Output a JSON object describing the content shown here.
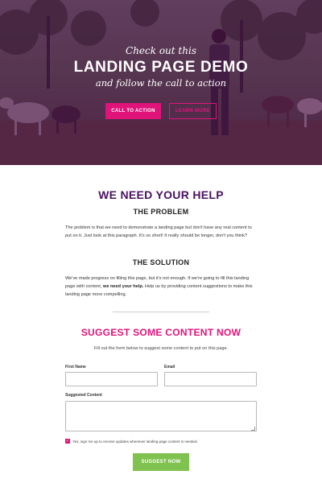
{
  "hero": {
    "kicker": "Check out this",
    "title": "LANDING PAGE DEMO",
    "subtitle": "and follow the call to action",
    "cta_label": "CALL TO ACTION",
    "learn_label": "LEARN MORE",
    "colors": {
      "overlay": "#480c4e",
      "accent": "#e0137b"
    }
  },
  "help": {
    "heading": "WE NEED YOUR HELP",
    "problem_heading": "THE PROBLEM",
    "problem_text": "The problem is that we need to demonstrate a landing page but don't have any real content to put on it. Just look at this paragraph. It's so short! It really should be longer, don't you think?",
    "solution_heading": "THE SOLUTION",
    "solution_text_before": "We've made progress on filling this page, but it's not enough. If we're going to fill this landing page with content, ",
    "solution_text_bold": "we need your help.",
    "solution_text_after": " Help us by providing content suggestions to make this landing page more compelling."
  },
  "suggest": {
    "heading": "SUGGEST SOME CONTENT NOW",
    "intro": "Fill out the form below to suggest some content to put on this page.",
    "first_name_label": "First Name",
    "first_name_value": "",
    "email_label": "Email",
    "email_value": "",
    "content_label": "Suggested Content",
    "content_value": "",
    "checkbox_label": "Yes, sign me up to receive updates whenever landing page content is needed.",
    "checkbox_checked": true,
    "submit_label": "SUGGEST NOW",
    "colors": {
      "heading": "#e0137b",
      "submit": "#7fc24f",
      "primary_heading": "#4a1260"
    }
  }
}
